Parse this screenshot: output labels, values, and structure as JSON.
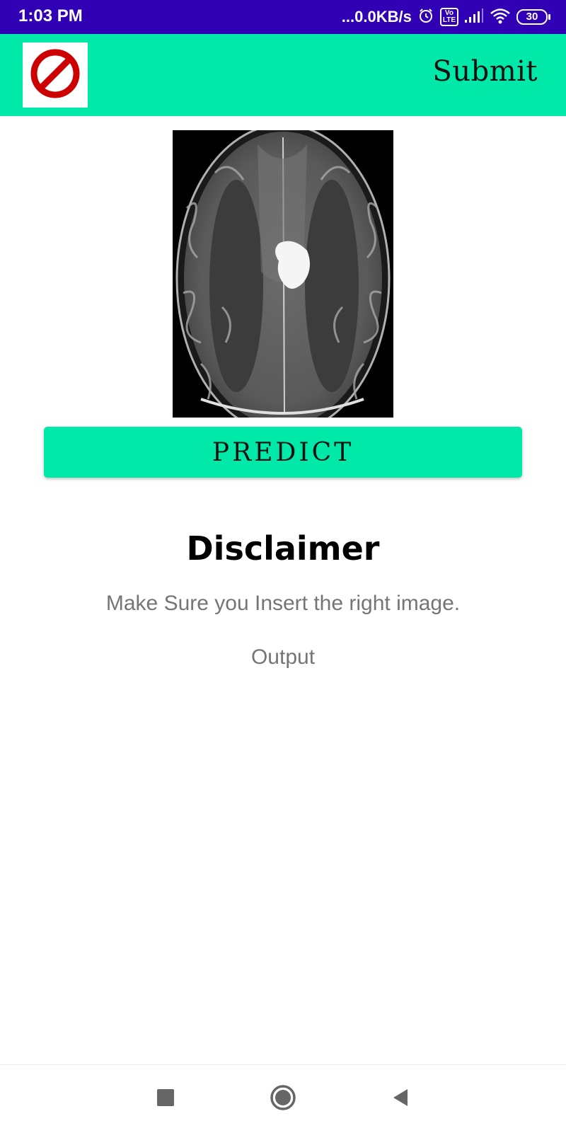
{
  "status_bar": {
    "time": "1:03 PM",
    "net_speed": "...0.0KB/s",
    "volte_label": "Vo\nLTE",
    "battery_level": "30",
    "icons": [
      "alarm-icon",
      "volte-icon",
      "signal-icon",
      "wifi-icon",
      "battery-icon"
    ]
  },
  "app_bar": {
    "logo_icon": "no-entry-icon",
    "submit_label": "Submit",
    "background": "#00e9a8"
  },
  "main": {
    "image_description_icon": "mri-scan-image",
    "predict_label": "PREDICT",
    "disclaimer_title": "Disclaimer",
    "disclaimer_text": "Make Sure you Insert the right image.",
    "output_label": "Output"
  },
  "nav_bar": {
    "icons": [
      "recent-apps-icon",
      "home-icon",
      "back-icon"
    ]
  },
  "colors": {
    "status_bar": "#3100b4",
    "accent": "#00e9a8",
    "logo_red": "#cc0000",
    "secondary_text": "#757575"
  }
}
